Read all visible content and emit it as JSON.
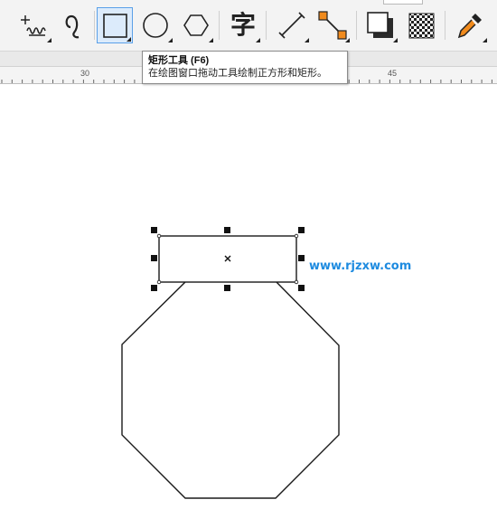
{
  "toolbar": {
    "tools": [
      {
        "name": "freehand-tool",
        "icon": "freehand-icon"
      },
      {
        "name": "smart-drawing-tool",
        "icon": "smart-drawing-icon"
      },
      {
        "name": "rectangle-tool",
        "icon": "rectangle-icon",
        "active": true
      },
      {
        "name": "ellipse-tool",
        "icon": "ellipse-icon"
      },
      {
        "name": "polygon-tool",
        "icon": "polygon-icon"
      },
      {
        "name": "text-tool",
        "icon": "text-icon",
        "glyph": "字"
      },
      {
        "name": "parallel-dimension-tool",
        "icon": "dimension-icon"
      },
      {
        "name": "connector-tool",
        "icon": "connector-icon"
      },
      {
        "name": "drop-shadow-tool",
        "icon": "drop-shadow-icon"
      },
      {
        "name": "transparency-tool",
        "icon": "transparency-icon"
      },
      {
        "name": "eyedropper-tool",
        "icon": "eyedropper-icon"
      }
    ],
    "active_color": "#5aa0e8"
  },
  "ruler": {
    "labels": [
      "30",
      "45"
    ]
  },
  "tooltip": {
    "title": "矩形工具 (F6)",
    "description": "在绘图窗口拖动工具绘制正方形和矩形。"
  },
  "watermark": {
    "text": "www.rjzxw.com",
    "color": "#1e8be0"
  },
  "canvas": {
    "shapes": [
      {
        "type": "rectangle",
        "state": "selected"
      },
      {
        "type": "octagon",
        "state": "normal"
      }
    ]
  }
}
